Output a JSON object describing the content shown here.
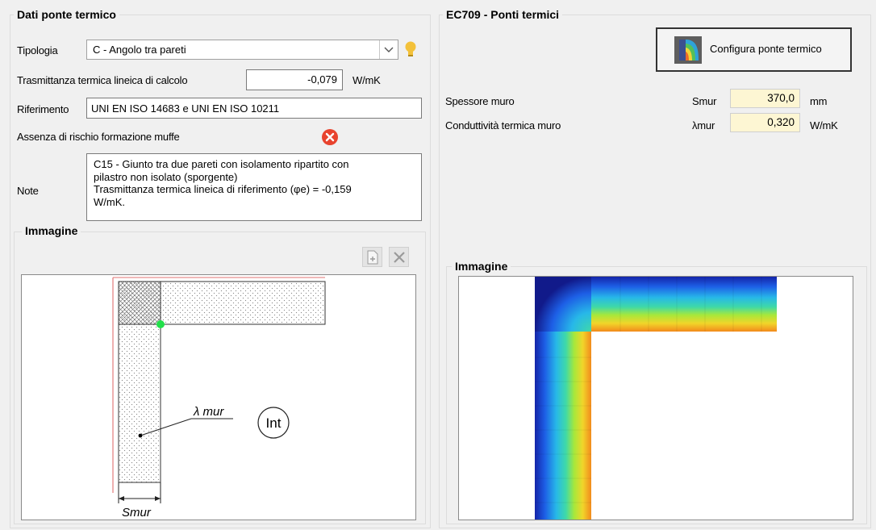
{
  "left": {
    "title": "Dati ponte termico",
    "tipologia_label": "Tipologia",
    "tipologia_value": "C - Angolo tra pareti",
    "trasmittanza_label": "Trasmittanza termica lineica di calcolo",
    "trasmittanza_value": "-0,079",
    "trasmittanza_unit": "W/mK",
    "riferimento_label": "Riferimento",
    "riferimento_value": "UNI EN ISO 14683 e UNI EN ISO 10211",
    "muffe_label": "Assenza di rischio formazione muffe",
    "note_label": "Note",
    "note_lines": [
      "C15 - Giunto tra due pareti con isolamento ripartito con",
      "pilastro non isolato (sporgente)",
      "Trasmittanza termica lineica di riferimento (φe) = -0,159",
      "W/mK."
    ],
    "immagine_title": "Immagine",
    "diagram": {
      "lambda_label": "λ mur",
      "int_label": "Int",
      "s_label": "Smur"
    }
  },
  "right": {
    "title": "EC709 - Ponti termici",
    "config_button": "Configura ponte termico",
    "fields": [
      {
        "label": "Spessore muro",
        "symbol": "Smur",
        "value": "370,0",
        "unit": "mm"
      },
      {
        "label": "Conduttività termica muro",
        "symbol": "λmur",
        "value": "0,320",
        "unit": "W/mK"
      }
    ],
    "immagine_title": "Immagine"
  },
  "icons": {
    "dropdown": "chevron-down-icon",
    "hint": "lightbulb-icon",
    "status": "error-x-icon",
    "add_image": "add-image-icon",
    "delete_image": "delete-x-icon",
    "config": "thermal-bridge-icon"
  },
  "colors": {
    "status_red": "#e8432e",
    "field_yellow": "#fdf6d3",
    "hint_yellow": "#f3c13a"
  }
}
